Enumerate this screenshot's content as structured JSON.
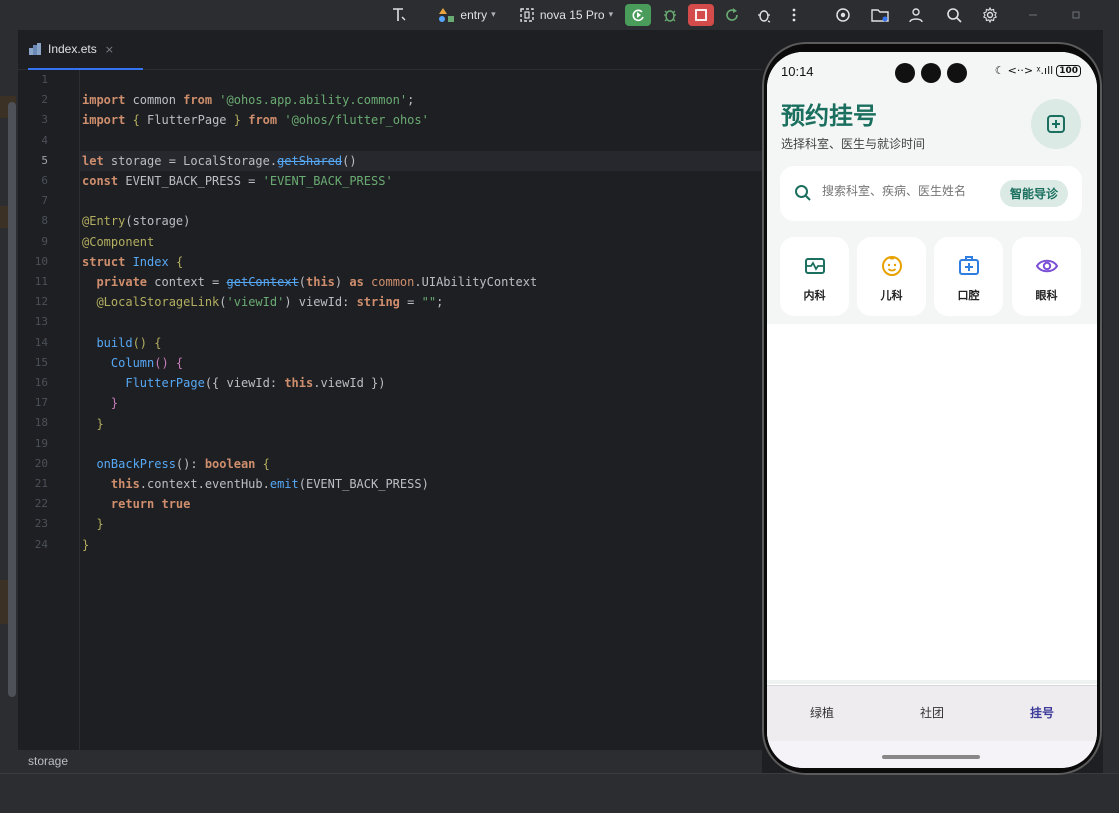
{
  "toolbar": {
    "run_config": "entry",
    "device": "nova 15 Pro",
    "colors": {
      "run": "#4a9c5b",
      "stop": "#d34b4b"
    }
  },
  "editor": {
    "tab": {
      "name": "Index.ets",
      "close": "×"
    },
    "line_numbers": [
      "1",
      "2",
      "3",
      "4",
      "5",
      "6",
      "7",
      "8",
      "9",
      "10",
      "11",
      "12",
      "13",
      "14",
      "15",
      "16",
      "17",
      "18",
      "19",
      "20",
      "21",
      "22",
      "23",
      "24"
    ],
    "current_line": "5",
    "code": {
      "l2": {
        "kw": "import",
        "id": " common ",
        "kw2": "from",
        "str": " '@ohos.app.ability.common'",
        "end": ";"
      },
      "l3": {
        "kw": "import",
        "b1": " { ",
        "id": "FlutterPage",
        "b2": " } ",
        "kw2": "from",
        "str": " '@ohos/flutter_ohos'"
      },
      "l5": {
        "kw": "let",
        "id": " storage = LocalStorage.",
        "fn": "getShared",
        "end": "()"
      },
      "l6": {
        "kw": "const",
        "id": " EVENT_BACK_PRESS = ",
        "str": "'EVENT_BACK_PRESS'"
      },
      "l8": {
        "dec": "@Entry",
        "rest": "(storage)"
      },
      "l9": {
        "dec": "@Component"
      },
      "l10": {
        "kw": "struct",
        "type": " Index",
        "rest": " {"
      },
      "l11": {
        "kw": "  private",
        "id": " context = ",
        "fn": "getContext",
        "p1": "(",
        "kw2": "this",
        "p2": ") ",
        "kw3": "as",
        "mod": " common",
        "rest": ".UIAbilityContext"
      },
      "l12": {
        "dec": "  @LocalStorageLink",
        "p1": "(",
        "str": "'viewId'",
        "p2": ") viewId: ",
        "kw": "string",
        "rest": " = ",
        "str2": "\"\"",
        "end": ";"
      },
      "l14": {
        "fn": "  build",
        "rest": "() {"
      },
      "l15": {
        "fn": "    Column",
        "rest": "() {"
      },
      "l16": {
        "fn": "      FlutterPage",
        "p1": "({ viewId: ",
        "kw": "this",
        "rest": ".viewId })"
      },
      "l17": {
        "rest": "    }"
      },
      "l18": {
        "rest": "  }"
      },
      "l20": {
        "fn": "  onBackPress",
        "p1": "(): ",
        "kw": "boolean",
        "rest": " {"
      },
      "l21": {
        "kw": "    this",
        "p1": ".context.eventHub.",
        "fn": "emit",
        "rest": "(EVENT_BACK_PRESS)"
      },
      "l22": {
        "kw": "    return true"
      },
      "l23": {
        "rest": "  }"
      },
      "l24": {
        "rest": "}"
      }
    },
    "status": "storage"
  },
  "phone": {
    "status_bar": {
      "time": "10:14",
      "signal": "<··> ᵡ.ıll",
      "battery": "100"
    },
    "header": {
      "title": "预约挂号",
      "subtitle": "选择科室、医生与就诊时间"
    },
    "search": {
      "placeholder": "搜索科室、疾病、医生姓名",
      "guide_button": "智能导诊"
    },
    "departments": [
      {
        "label": "内科",
        "icon": "heart-monitor-icon",
        "color": "#1a6f5e"
      },
      {
        "label": "儿科",
        "icon": "child-face-icon",
        "color": "#e8a200"
      },
      {
        "label": "口腔",
        "icon": "medical-kit-icon",
        "color": "#2f7de1"
      },
      {
        "label": "眼科",
        "icon": "eye-icon",
        "color": "#7a4fd6"
      }
    ],
    "nav": [
      {
        "label": "绿植",
        "active": false
      },
      {
        "label": "社团",
        "active": false
      },
      {
        "label": "挂号",
        "active": true
      }
    ],
    "colors": {
      "brand": "#1a6f5e",
      "nav_active": "#3d3b9a"
    }
  }
}
